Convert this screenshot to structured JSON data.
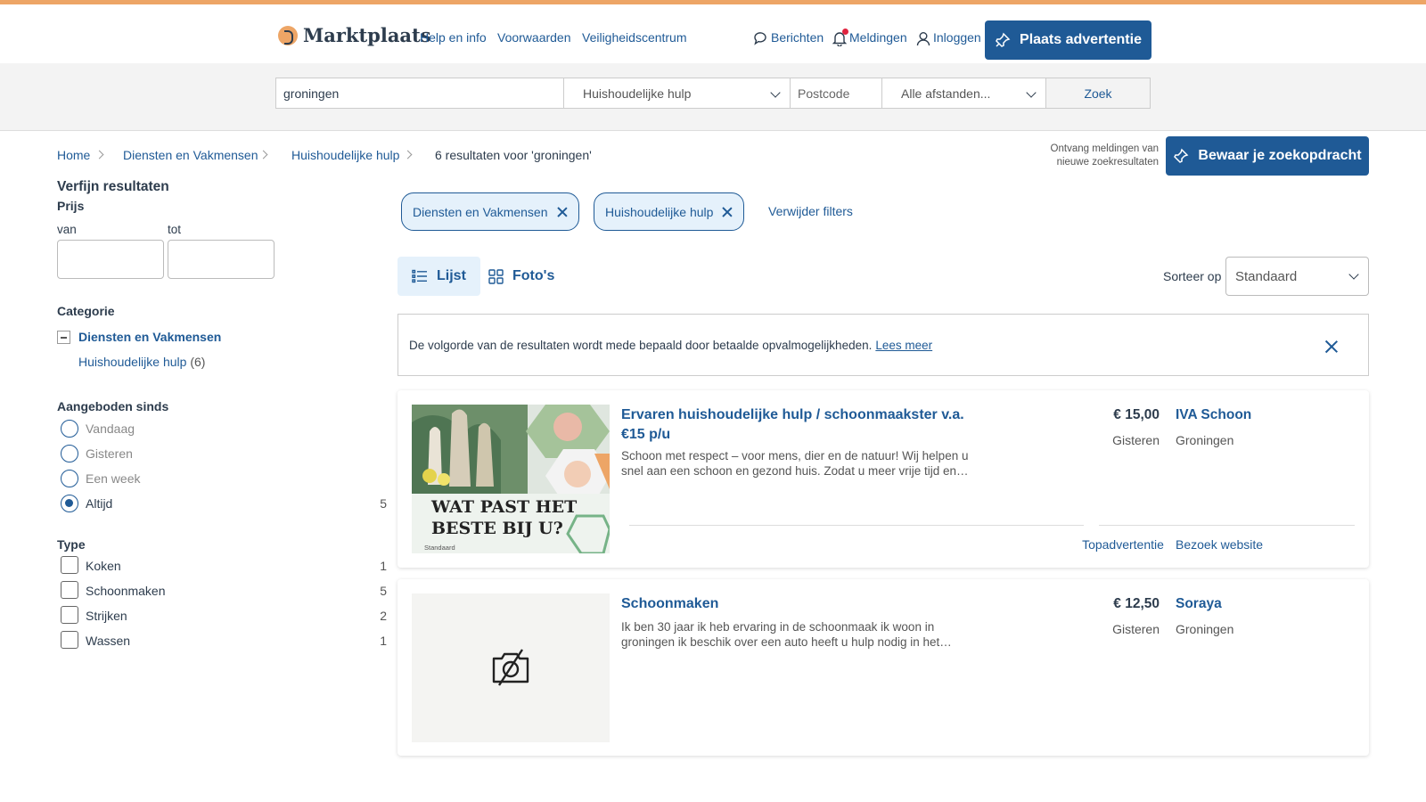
{
  "header": {
    "logo_text": "Marktplaats",
    "links": [
      "Help en info",
      "Voorwaarden",
      "Veiligheidscentrum"
    ],
    "berichten": "Berichten",
    "meldingen": "Meldingen",
    "inloggen": "Inloggen",
    "place_ad": "Plaats advertentie"
  },
  "search": {
    "query": "groningen",
    "category": "Huishoudelijke hulp",
    "postcode_placeholder": "Postcode",
    "distance": "Alle afstanden...",
    "submit": "Zoek"
  },
  "breadcrumb": {
    "items": [
      "Home",
      "Diensten en Vakmensen",
      "Huishoudelijke hulp"
    ],
    "results": "6 resultaten voor 'groningen'"
  },
  "save_search": {
    "note": "Ontvang meldingen van nieuwe zoekresultaten",
    "button": "Bewaar je zoekopdracht"
  },
  "sidebar": {
    "title": "Verfijn resultaten",
    "price_title": "Prijs",
    "price_from": "van",
    "price_to": "tot",
    "category_title": "Categorie",
    "category_parent": "Diensten en Vakmensen",
    "category_child": "Huishoudelijke hulp",
    "category_child_count": "(6)",
    "since_title": "Aangeboden sinds",
    "since_options": [
      {
        "label": "Vandaag",
        "count": ""
      },
      {
        "label": "Gisteren",
        "count": ""
      },
      {
        "label": "Een week",
        "count": ""
      },
      {
        "label": "Altijd",
        "count": "5"
      }
    ],
    "type_title": "Type",
    "type_options": [
      {
        "label": "Koken",
        "count": "1"
      },
      {
        "label": "Schoonmaken",
        "count": "5"
      },
      {
        "label": "Strijken",
        "count": "2"
      },
      {
        "label": "Wassen",
        "count": "1"
      }
    ]
  },
  "filters": {
    "chips": [
      "Diensten en Vakmensen",
      "Huishoudelijke hulp"
    ],
    "clear": "Verwijder filters"
  },
  "view": {
    "list": "Lijst",
    "photos": "Foto's",
    "sort_label": "Sorteer op",
    "sort_value": "Standaard"
  },
  "notice": {
    "text": "De volgorde van de resultaten wordt mede bepaald door betaalde opvalmogelijkheden.",
    "link": "Lees meer"
  },
  "listings": [
    {
      "title": "Ervaren huishoudelijke hulp / schoonmaakster v.a. €15 p/u",
      "description": "Schoon met respect – voor mens, dier en de natuur! Wij helpen u snel aan een schoon en gezond huis. Zodat u meer vrije tijd en…",
      "price": "€ 15,00",
      "date": "Gisteren",
      "seller": "IVA Schoon",
      "city": "Groningen",
      "badge": "Topadvertentie",
      "website": "Bezoek website",
      "image_text": "WAT PAST HET BESTE BIJ U?",
      "image_caption": "Standaard"
    },
    {
      "title": "Schoonmaken",
      "description": "Ik ben 30 jaar ik heb ervaring in de schoonmaak ik woon in groningen ik beschik over een auto heeft u hulp nodig in het…",
      "price": "€ 12,50",
      "date": "Gisteren",
      "seller": "Soraya",
      "city": "Groningen"
    }
  ],
  "colors": {
    "accent": "#1f5a96",
    "brand": "#eda566",
    "chip_bg": "#e5f1fb"
  }
}
